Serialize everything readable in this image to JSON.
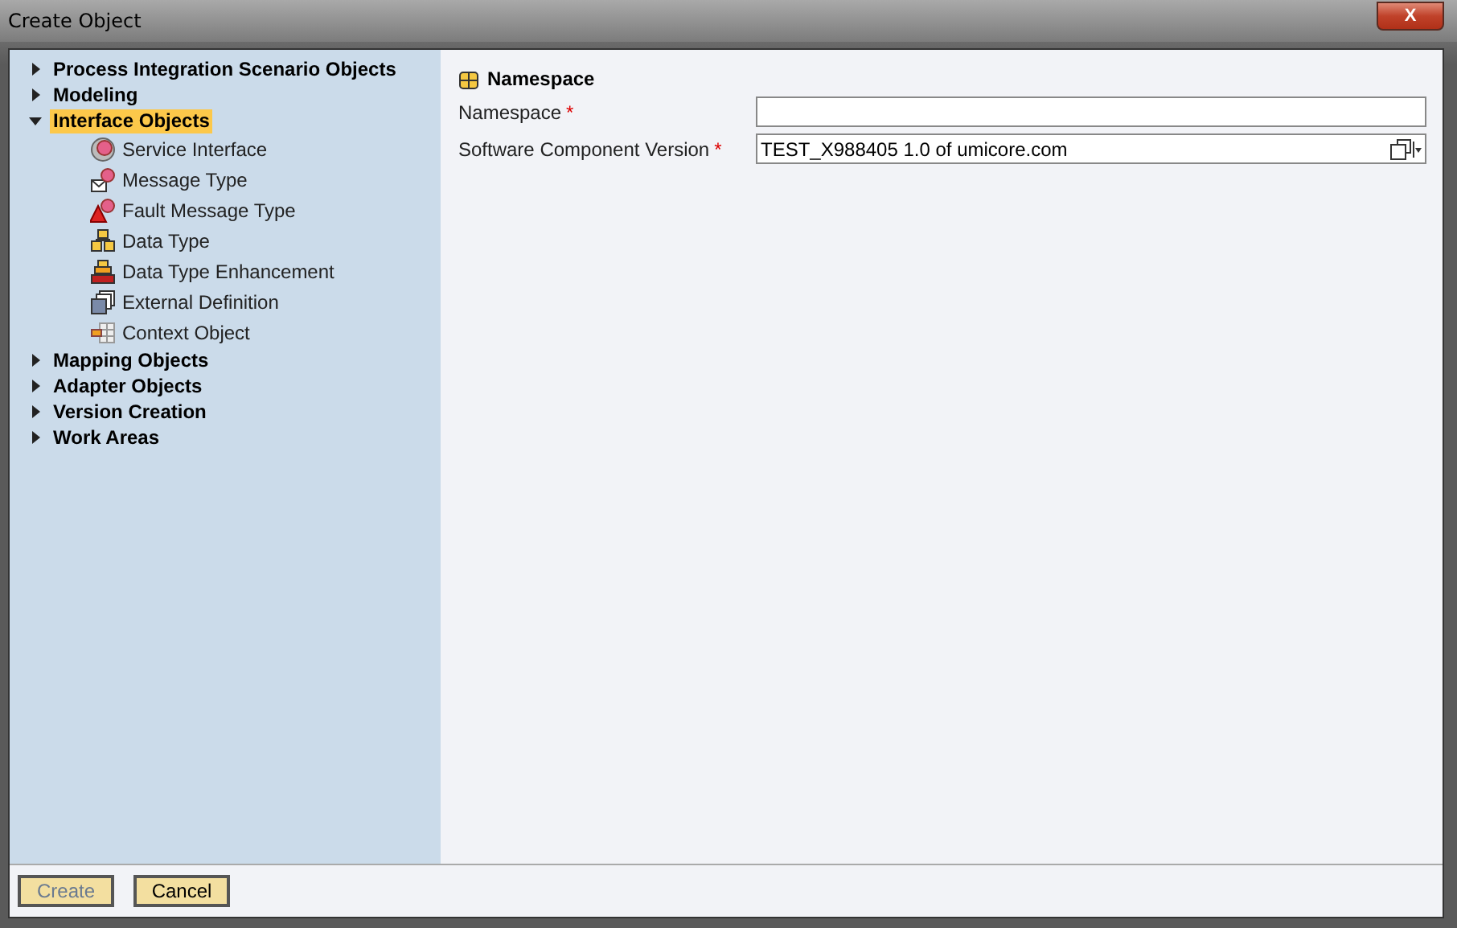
{
  "window": {
    "title": "Create Object",
    "close_label": "X"
  },
  "tree": [
    {
      "label": "Process Integration Scenario Objects",
      "expanded": false,
      "selected": false
    },
    {
      "label": "Modeling",
      "expanded": false,
      "selected": false
    },
    {
      "label": "Interface Objects",
      "expanded": true,
      "selected": true,
      "children": [
        {
          "label": "Service Interface",
          "kind": "service"
        },
        {
          "label": "Message Type",
          "kind": "message"
        },
        {
          "label": "Fault Message Type",
          "kind": "fault"
        },
        {
          "label": "Data Type",
          "kind": "datatype"
        },
        {
          "label": "Data Type Enhancement",
          "kind": "enhancement"
        },
        {
          "label": "External Definition",
          "kind": "external"
        },
        {
          "label": "Context Object",
          "kind": "context"
        }
      ]
    },
    {
      "label": "Mapping Objects",
      "expanded": false,
      "selected": false
    },
    {
      "label": "Adapter Objects",
      "expanded": false,
      "selected": false
    },
    {
      "label": "Version Creation",
      "expanded": false,
      "selected": false
    },
    {
      "label": "Work Areas",
      "expanded": false,
      "selected": false
    }
  ],
  "form": {
    "heading": "Namespace",
    "fields": [
      {
        "label": "Namespace",
        "required_mark": "*",
        "kind": "text"
      },
      {
        "label": "Software Component Version",
        "required_mark": "*",
        "value": "TEST_X988405 1.0 of umicore.com",
        "kind": "lookup"
      }
    ]
  },
  "buttons": [
    {
      "label": "Create",
      "disabled": true
    },
    {
      "label": "Cancel",
      "disabled": false
    }
  ]
}
